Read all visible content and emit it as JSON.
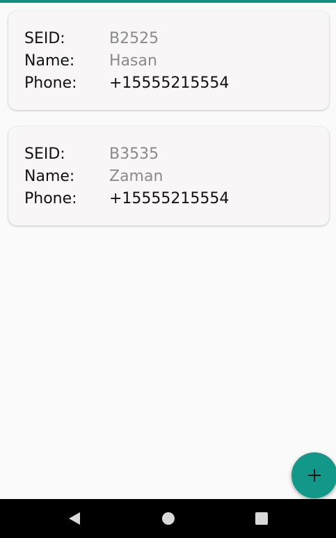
{
  "labels": {
    "seid": "SEID:",
    "name": "Name:",
    "phone": "Phone:"
  },
  "contacts": [
    {
      "seid": "B2525",
      "name": "Hasan",
      "phone": "+15555215554"
    },
    {
      "seid": "B3535",
      "name": "Zaman",
      "phone": "+15555215554"
    }
  ],
  "fab": {
    "icon": "plus-icon"
  },
  "navbar": {
    "back_icon": "back-triangle-icon",
    "home_icon": "home-circle-icon",
    "recents_icon": "recents-square-icon"
  },
  "colors": {
    "accent": "#139788",
    "top_bar": "#168f7f",
    "card_bg": "#f8f6f6",
    "muted_text": "#8a8a8a",
    "page_bg": "#fafafa",
    "navbar_bg": "#000000"
  }
}
